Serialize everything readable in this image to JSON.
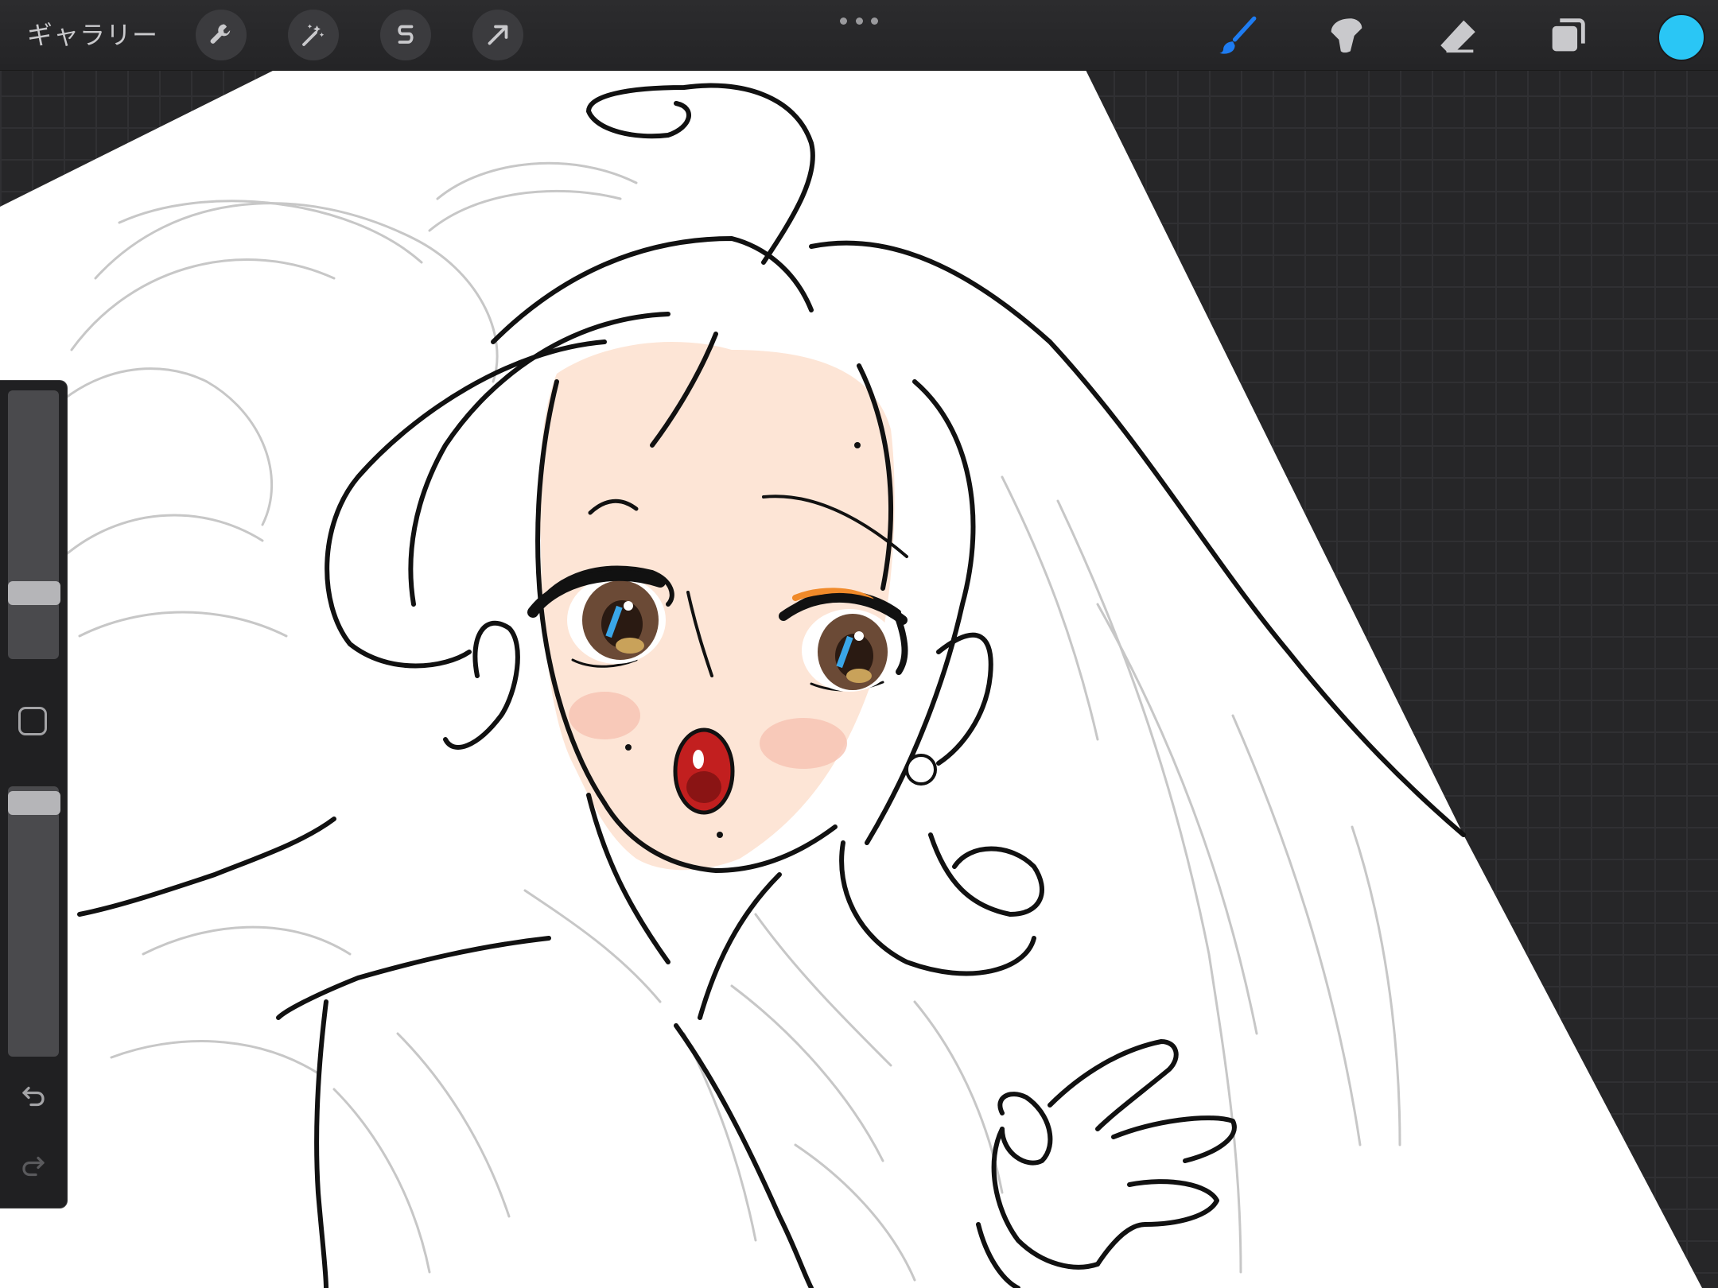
{
  "topbar": {
    "gallery_label": "ギャラリー",
    "left_tools": [
      {
        "icon": "wrench-icon"
      },
      {
        "icon": "magic-wand-icon"
      },
      {
        "icon": "selection-s-icon"
      },
      {
        "icon": "transform-arrow-icon"
      }
    ],
    "more_icon": "more-dots-icon",
    "right_tools": [
      {
        "icon": "brush-icon",
        "active": true
      },
      {
        "icon": "smudge-icon",
        "active": false
      },
      {
        "icon": "eraser-icon",
        "active": false
      },
      {
        "icon": "layers-icon",
        "active": false
      }
    ],
    "current_color": "#2ac6f5",
    "active_tool_color": "#1e7cf2"
  },
  "sidebar": {
    "brush_size_level": 0.18,
    "opacity_level": 0.95,
    "modify_icon": "modify-square-icon",
    "undo_icon": "undo-icon",
    "redo_icon": "redo-icon"
  },
  "canvas": {
    "paper_color": "#ffffff",
    "skin_color": "#fde5d6",
    "lip_color": "#c21f1f",
    "iris_color": "#6b4a36"
  }
}
